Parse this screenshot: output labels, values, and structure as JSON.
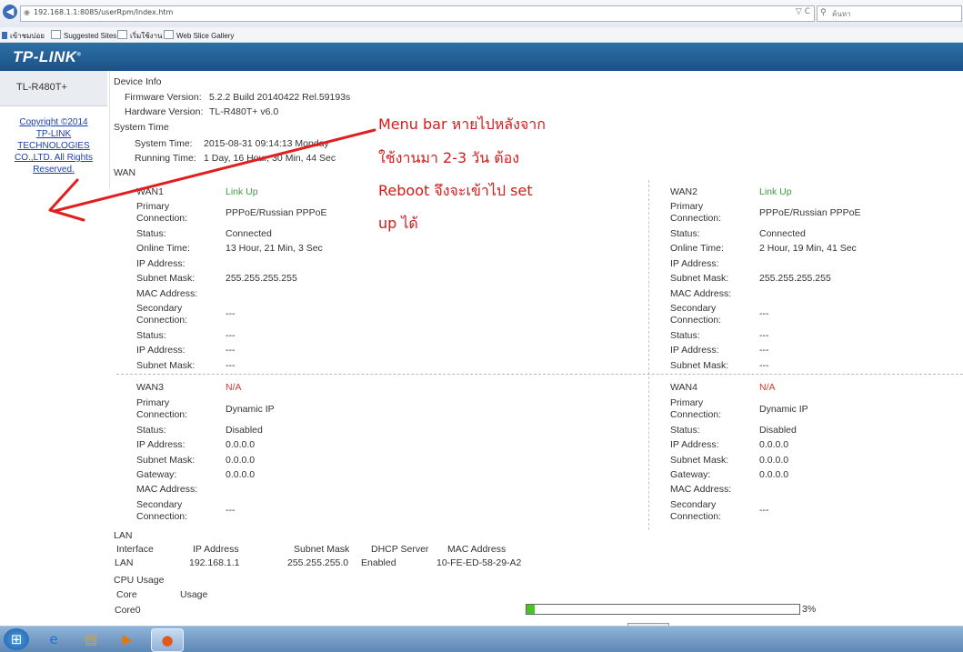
{
  "browser": {
    "url": "192.168.1.1:8085/userRpm/Index.htm",
    "url_icons": "▽ C",
    "search_placeholder": "ค้นหา",
    "favorites": [
      "เข้าชมบ่อย",
      "Suggested Sites",
      "เริ่มใช้งาน",
      "Web Slice Gallery"
    ]
  },
  "header": {
    "logo": "TP-LINK"
  },
  "sidebar": {
    "model": "TL-R480T+",
    "copyright_lines": [
      "Copyright ©2014",
      "TP-LINK",
      "TECHNOLOGIES",
      "CO.,LTD. All Rights",
      "Reserved."
    ]
  },
  "device_info": {
    "title": "Device Info",
    "firmware_label": "Firmware Version:",
    "firmware_value": "5.2.2 Build 20140422 Rel.59193s",
    "hardware_label": "Hardware Version:",
    "hardware_value": "TL-R480T+ v6.0"
  },
  "system_time": {
    "title": "System Time",
    "time_label": "System Time:",
    "time_value": "2015-08-31 09:14:13 Monday",
    "running_label": "Running Time:",
    "running_value": "1 Day, 16 Hour, 30 Min, 44 Sec"
  },
  "wan": {
    "title": "WAN",
    "labels": {
      "primary": [
        "Primary",
        "Connection:"
      ],
      "status": "Status:",
      "online": "Online Time:",
      "ip": "IP Address:",
      "subnet": "Subnet Mask:",
      "gateway": "Gateway:",
      "mac": "MAC Address:",
      "secondary": [
        "Secondary",
        "Connection:"
      ]
    },
    "wan1": {
      "name": "WAN1",
      "state": "Link Up",
      "primary": "PPPoE/Russian PPPoE",
      "status": "Connected",
      "online": "13 Hour, 21 Min, 3 Sec",
      "ip": "",
      "subnet": "255.255.255.255",
      "mac": "",
      "secondary": "---",
      "sec_status": "---",
      "sec_ip": "---",
      "sec_subnet": "---"
    },
    "wan2": {
      "name": "WAN2",
      "state": "Link Up",
      "primary": "PPPoE/Russian PPPoE",
      "status": "Connected",
      "online": "2 Hour, 19 Min, 41 Sec",
      "ip": "",
      "subnet": "255.255.255.255",
      "mac": "",
      "secondary": "---",
      "sec_status": "---",
      "sec_ip": "---",
      "sec_subnet": "---"
    },
    "wan3": {
      "name": "WAN3",
      "state": "N/A",
      "primary": "Dynamic IP",
      "status": "Disabled",
      "ip": "0.0.0.0",
      "subnet": "0.0.0.0",
      "gateway": "0.0.0.0",
      "mac": "",
      "secondary": "---"
    },
    "wan4": {
      "name": "WAN4",
      "state": "N/A",
      "primary": "Dynamic IP",
      "status": "Disabled",
      "ip": "0.0.0.0",
      "subnet": "0.0.0.0",
      "gateway": "0.0.0.0",
      "mac": "",
      "secondary": "---"
    }
  },
  "lan": {
    "title": "LAN",
    "headers": [
      "Interface",
      "IP Address",
      "Subnet Mask",
      "DHCP Server",
      "MAC Address"
    ],
    "row": [
      "LAN",
      "192.168.1.1",
      "255.255.255.0",
      "Enabled",
      "10-FE-ED-58-29-A2"
    ]
  },
  "cpu": {
    "title": "CPU Usage",
    "headers": [
      "Core",
      "Usage"
    ],
    "core": "Core0",
    "usage_percent": 3,
    "usage_label": "3%"
  },
  "annotation": {
    "lines": [
      "Menu bar หายไปหลังจาก",
      "ใช้งานมา   2-3 วัน   ต้อง",
      "Reboot จึงจะเข้าไป   set",
      "up ได้"
    ],
    "color": "#d51a1a"
  }
}
